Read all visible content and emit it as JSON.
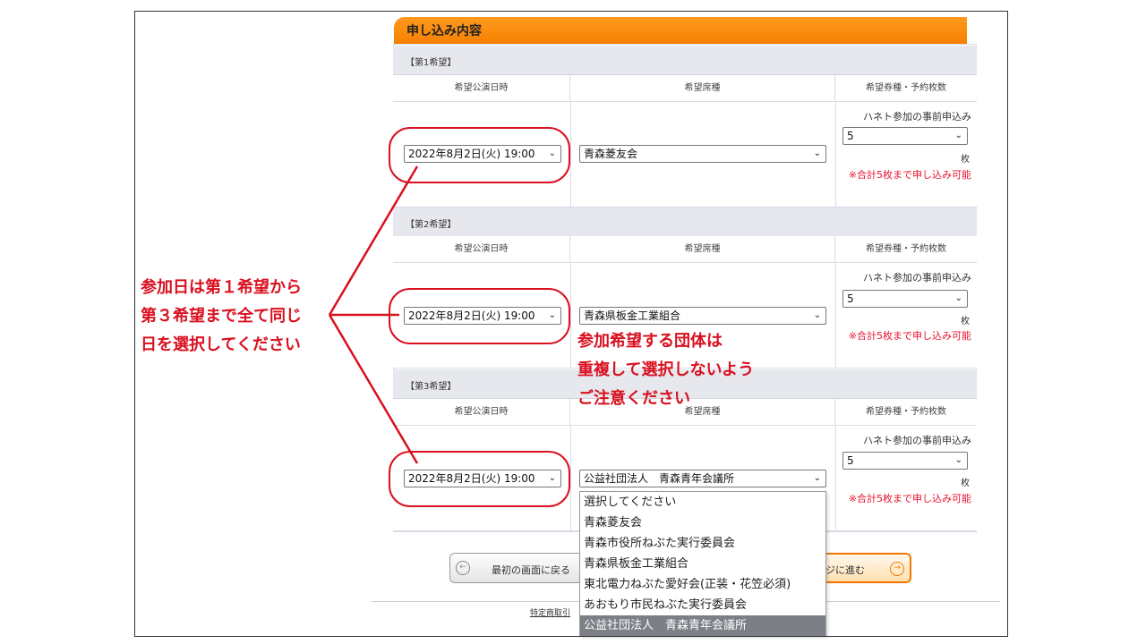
{
  "section_title": "申し込み内容",
  "headers": {
    "date": "希望公演日時",
    "seat": "希望席種",
    "ticket": "希望券種・予約枚数"
  },
  "choices": [
    {
      "label": "【第1希望】",
      "date": "2022年8月2日(火) 19:00",
      "group": "青森菱友会",
      "ticket_type": "ハネト参加の事前申込み",
      "count": "5",
      "unit": "枚",
      "note": "※合計5枚まで申し込み可能"
    },
    {
      "label": "【第2希望】",
      "date": "2022年8月2日(火) 19:00",
      "group": "青森県板金工業組合",
      "ticket_type": "ハネト参加の事前申込み",
      "count": "5",
      "unit": "枚",
      "note": "※合計5枚まで申し込み可能"
    },
    {
      "label": "【第3希望】",
      "date": "2022年8月2日(火) 19:00",
      "group": "公益社団法人　青森青年会議所",
      "ticket_type": "ハネト参加の事前申込み",
      "count": "5",
      "unit": "枚",
      "note": "※合計5枚まで申し込み可能"
    }
  ],
  "dropdown_options": [
    "選択してください",
    "青森菱友会",
    "青森市役所ねぶた実行委員会",
    "青森県板金工業組合",
    "東北電力ねぶた愛好会(正装・花笠必須)",
    "あおもり市民ねぶた実行委員会",
    "公益社団法人　青森青年会議所"
  ],
  "buttons": {
    "back": "最初の画面に戻る",
    "next": "ジに進む"
  },
  "footer_link": "特定商取引",
  "annotations": {
    "left_lines": [
      "参加日は第１希望から",
      "第３希望まで全て同じ",
      "日を選択してください"
    ],
    "center_lines": [
      "参加希望する団体は",
      "重複して選択しないよう",
      "ご注意ください"
    ]
  },
  "colors": {
    "header_orange": "#f58000",
    "annotation_red": "#d9101f",
    "note_red": "#e8132c"
  }
}
